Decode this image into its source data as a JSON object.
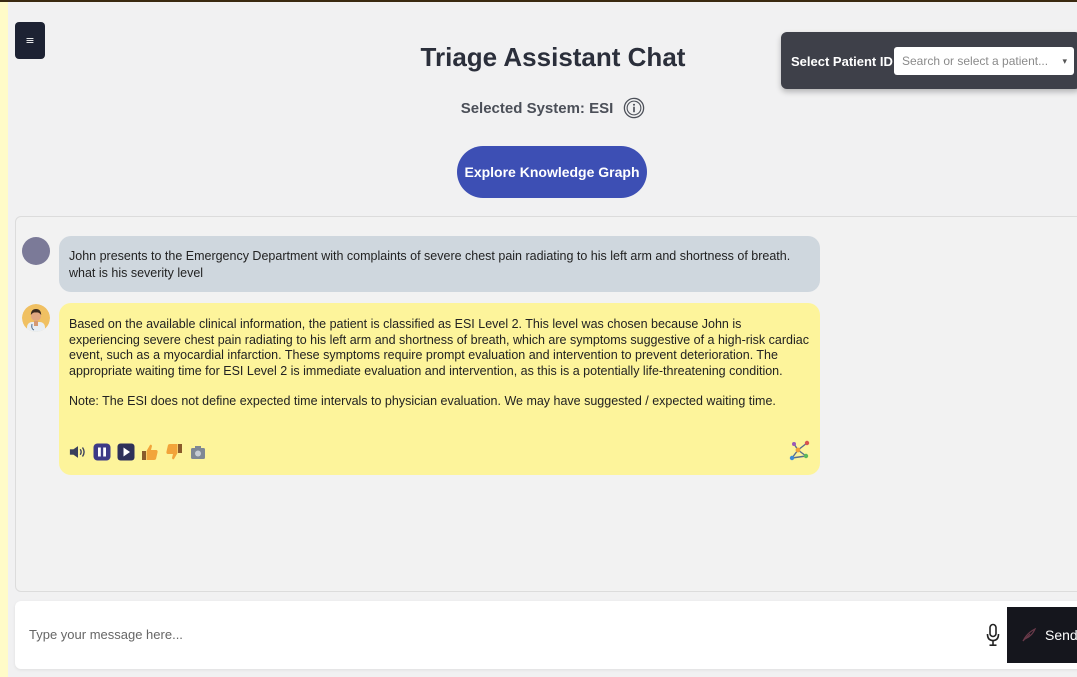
{
  "header": {
    "menu_icon": "hamburger-icon",
    "title": "Triage Assistant Chat",
    "selected_system_label": "Selected System: ESI",
    "info_icon": "info-circle-icon",
    "explore_button_label": "Explore Knowledge Graph"
  },
  "patient_selector": {
    "label": "Select Patient ID:",
    "placeholder": "Search or select a patient...",
    "caret": "▾"
  },
  "chat": {
    "messages": [
      {
        "role": "user",
        "text": "John presents to the Emergency Department with complaints of severe chest pain radiating to his left arm and shortness of breath. what is his severity level"
      },
      {
        "role": "assistant",
        "text": "Based on the available clinical information, the patient is classified as ESI Level 2. This level was chosen because John is experiencing severe chest pain radiating to his left arm and shortness of breath, which are symptoms suggestive of a high-risk cardiac event, such as a myocardial infarction. These symptoms require prompt evaluation and intervention to prevent deterioration. The appropriate waiting time for ESI Level 2 is immediate evaluation and intervention, as this is a potentially life-threatening condition.",
        "note": "Note: The ESI does not define expected time intervals to physician evaluation. We may have suggested / expected waiting time.",
        "actions": [
          "speaker-icon",
          "pause-icon",
          "play-icon",
          "thumbs-up-icon",
          "thumbs-down-icon",
          "camera-icon"
        ],
        "graph_icon": "knowledge-graph-icon"
      }
    ]
  },
  "input": {
    "placeholder": "Type your message here...",
    "mic_icon": "microphone-icon",
    "send_label": "Send",
    "send_icon": "send-feather-icon"
  },
  "colors": {
    "page_border": "#fffbc8",
    "assistant_bubble": "#fdf49b",
    "user_bubble": "#cfd7de",
    "primary_button": "#3d4fb4",
    "dark": "#15161d"
  }
}
